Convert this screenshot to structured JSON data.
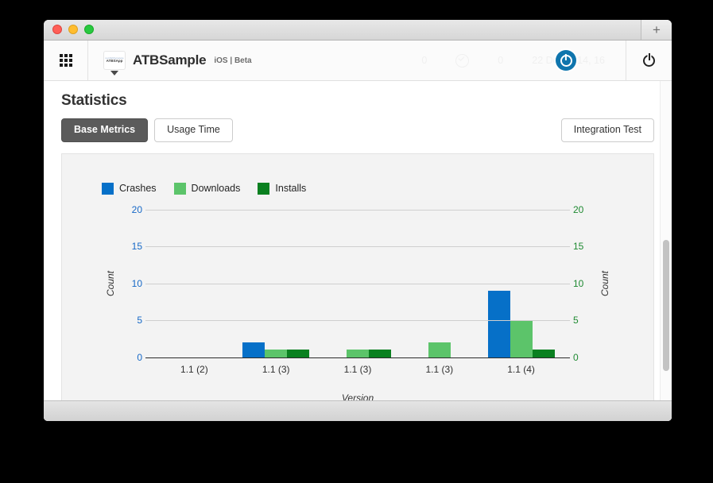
{
  "window": {
    "traffic_lights": [
      "close",
      "minimize",
      "zoom"
    ],
    "new_tab_label": "+"
  },
  "toolbar": {
    "grid_icon": "apps-grid-icon",
    "app_icon_line1": "nerdishbynature",
    "app_icon_line2": "ATBSApp",
    "app_name": "ATBSample",
    "app_platform": "iOS | Beta",
    "stat_crashes": "0",
    "stat_check_icon": "check-circle-icon",
    "stat_installs": "0",
    "stat_date": "22 Dec 2014, 16",
    "cursor_icon": "power-cursor-icon",
    "power_icon": "power-icon"
  },
  "page": {
    "title": "Statistics",
    "tabs": [
      {
        "label": "Base Metrics",
        "active": true
      },
      {
        "label": "Usage Time",
        "active": false
      }
    ],
    "integration_test_label": "Integration Test"
  },
  "colors": {
    "crashes": "#0670c8",
    "downloads": "#5cc46a",
    "installs": "#0a8020",
    "left_axis": "#1769c7",
    "right_axis": "#1f8a32",
    "panel_bg": "#f3f3f3",
    "active_tab_bg": "#5b5b5b"
  },
  "chart_data": {
    "type": "bar",
    "title": "",
    "xlabel": "Version",
    "ylabel": "Count",
    "y2label": "Count",
    "categories": [
      "1.1 (2)",
      "1.1 (3)",
      "1.1 (3)",
      "1.1 (3)",
      "1.1 (4)"
    ],
    "series": [
      {
        "name": "Crashes",
        "color": "#0670c8",
        "values": [
          0,
          2,
          0,
          0,
          9
        ]
      },
      {
        "name": "Downloads",
        "color": "#5cc46a",
        "values": [
          0,
          1,
          1,
          2,
          5
        ]
      },
      {
        "name": "Installs",
        "color": "#0a8020",
        "values": [
          0,
          1,
          1,
          0,
          1
        ]
      }
    ],
    "yticks": [
      0,
      5,
      10,
      15,
      20
    ],
    "y2ticks": [
      0,
      5,
      10,
      15,
      20
    ],
    "ylim": [
      0,
      20
    ],
    "y2lim": [
      0,
      20
    ],
    "grid": true,
    "legend_position": "top-left"
  }
}
